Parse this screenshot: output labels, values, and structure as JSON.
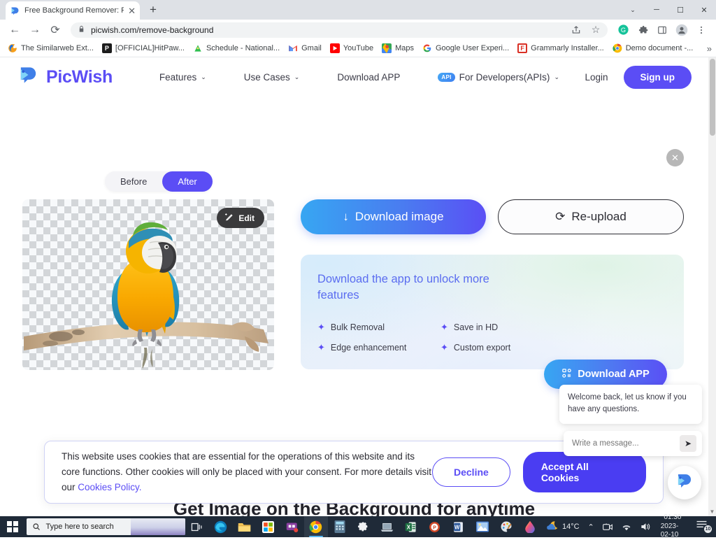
{
  "browser": {
    "tab": {
      "title": "Free Background Remover: Remo",
      "favicon": "picwish-icon",
      "close": "✕"
    },
    "new_tab_label": "+",
    "window_controls": {
      "chevron": "⌄",
      "minimize": "─",
      "maximize": "☐",
      "close": "✕"
    },
    "nav": {
      "back": "←",
      "forward": "→",
      "reload": "⟳"
    },
    "omnibox": {
      "lock": "lock-icon",
      "url": "picwish.com/remove-background",
      "share": "share-icon",
      "star": "☆"
    },
    "toolbar_icons": [
      "grammarly-icon",
      "extensions-icon",
      "sidepanel-icon",
      "profile-icon",
      "menu-icon"
    ],
    "bookmarks": [
      {
        "label": "The Similarweb Ext...",
        "icon": "similarweb-icon"
      },
      {
        "label": "[OFFICIAL]HitPaw...",
        "icon": "hitpaw-icon"
      },
      {
        "label": "Schedule - National...",
        "icon": "schedule-icon"
      },
      {
        "label": "Gmail",
        "icon": "gmail-icon"
      },
      {
        "label": "YouTube",
        "icon": "youtube-icon"
      },
      {
        "label": "Maps",
        "icon": "maps-icon"
      },
      {
        "label": "Google User Experi...",
        "icon": "google-icon"
      },
      {
        "label": "Grammarly Installer...",
        "icon": "grammarly-icon"
      },
      {
        "label": "Demo document -...",
        "icon": "chrome-icon"
      }
    ],
    "bookmarks_overflow": "»"
  },
  "site": {
    "logo_text": "PicWish",
    "nav": [
      {
        "label": "Features",
        "caret": "⌄"
      },
      {
        "label": "Use Cases",
        "caret": "⌄"
      },
      {
        "label": "Download APP",
        "caret": ""
      },
      {
        "label": "For Developers(APIs)",
        "caret": "⌄",
        "badge": "API"
      }
    ],
    "login_label": "Login",
    "signup_label": "Sign up"
  },
  "result": {
    "close_label": "✕",
    "toggle": {
      "before": "Before",
      "after": "After",
      "active": "After"
    },
    "edit_label": "Edit",
    "download_image_label": "Download image",
    "download_icon": "↓",
    "reupload_label": "Re-upload",
    "reupload_icon": "⟳"
  },
  "promo": {
    "title": "Download the app to unlock more features",
    "features": [
      "Bulk Removal",
      "Save in HD",
      "Edge enhancement",
      "Custom export"
    ],
    "bullet": "✦",
    "button_label": "Download APP",
    "button_icon": "qr-icon"
  },
  "chat": {
    "message": "Welcome back, let us know if you have any questions.",
    "input_placeholder": "Write a message...",
    "input_value": "",
    "send_icon": "➤",
    "launcher_icon": "picwish-logo-icon"
  },
  "cookie": {
    "text_part1": "This website uses cookies that are essential for the operations of this website and its core functions. Other cookies will only be placed with your consent. For more details visit our ",
    "link_text": "Cookies Policy.",
    "decline_label": "Decline",
    "accept_label": "Accept All Cookies"
  },
  "page_heading_partial": "Get Image on the Background for anytime",
  "taskbar": {
    "search_placeholder": "Type here to search",
    "apps": [
      "task-view-icon",
      "edge-icon",
      "file-explorer-icon",
      "microsoft-store-icon",
      "teams-icon",
      "chrome-icon",
      "calculator-icon",
      "settings-icon",
      "laptop-icon",
      "excel-icon",
      "powerpoint-icon",
      "word-icon",
      "photos-icon",
      "paint-icon",
      "colordrop-icon"
    ],
    "weather": "14°C",
    "weather_icon": "moon-cloud-icon",
    "tray_chevron": "⌃",
    "tray_icons": [
      "meet-icon",
      "wifi-icon",
      "volume-icon"
    ],
    "time": "01.30",
    "date": "2023-02-10",
    "notification_count": "10"
  },
  "colors": {
    "brand_purple": "#5b4df5",
    "accent_blue": "#37a6f2",
    "taskbar": "#1f2a38",
    "tabstrip": "#dee1e6"
  }
}
